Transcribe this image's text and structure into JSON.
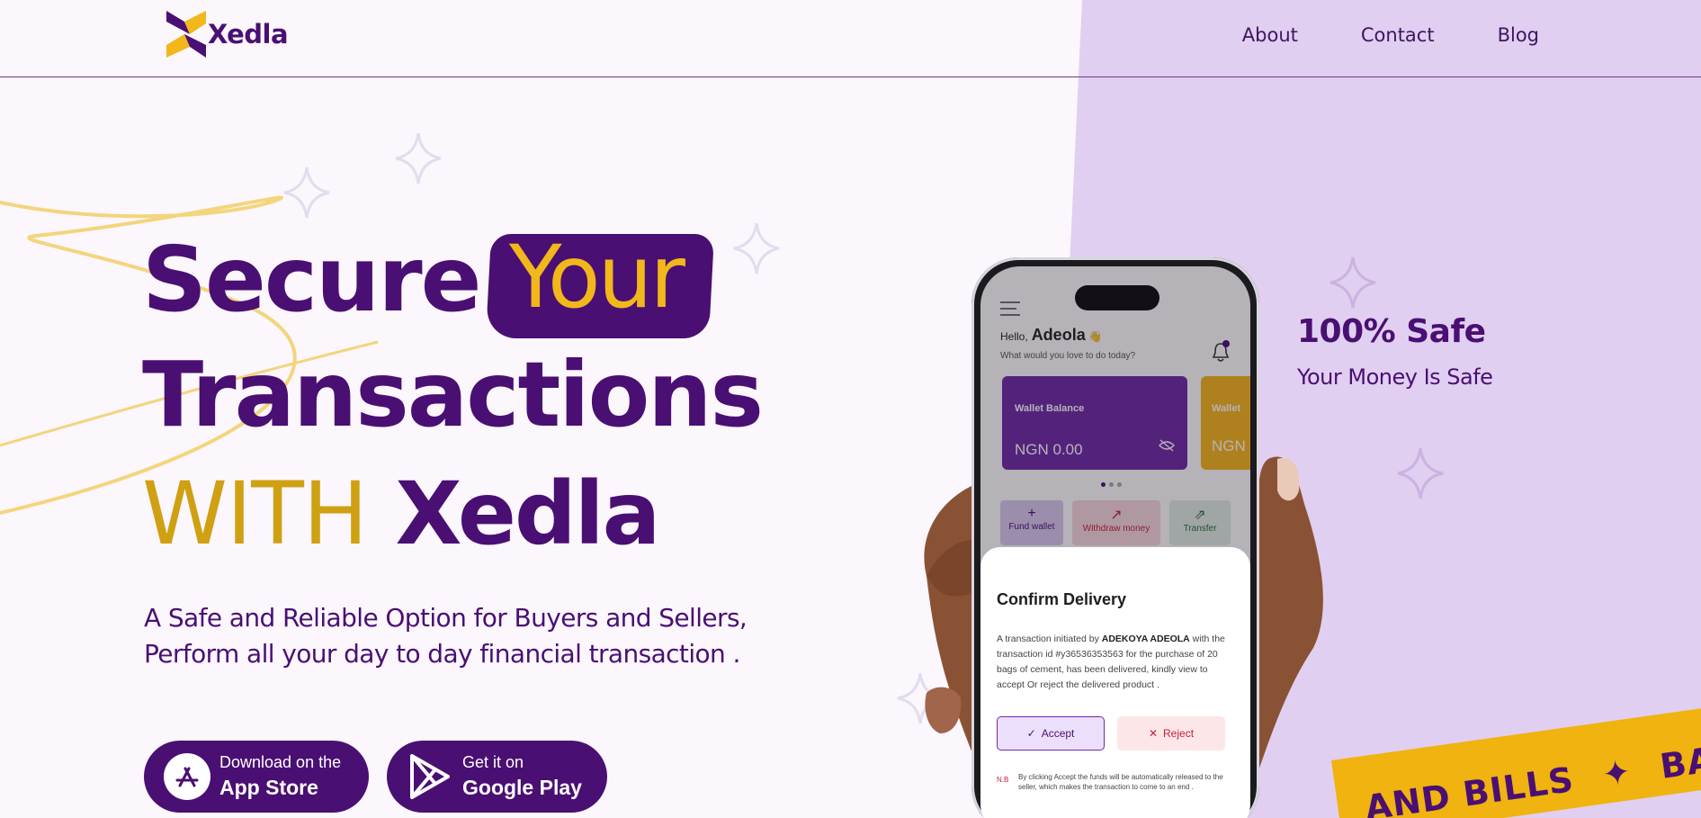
{
  "brand": {
    "name": "Xedla",
    "primary": "#4a0f73",
    "accent": "#f2b71a",
    "panel": "#e0cff0"
  },
  "nav": {
    "items": [
      "About",
      "Contact",
      "Blog"
    ]
  },
  "hero": {
    "line1_secure": "Secure",
    "line1_your": "Your",
    "line2": "Transactions",
    "line3_with": "WITH",
    "line3_brand": "Xedla",
    "subtitle_line1": "A Safe and Reliable Option for Buyers and Sellers,",
    "subtitle_line2": "Perform all your day to day financial transaction ."
  },
  "stores": {
    "apple": {
      "small": "Download on the",
      "big": "App Store",
      "icon": "app-store-icon"
    },
    "google": {
      "small": "Get it on",
      "big": "Google Play",
      "icon": "google-play-icon"
    }
  },
  "feature": {
    "title": "100% Safe",
    "subtitle": "Your Money Is Safe"
  },
  "ribbon": {
    "text": "AND BILLS",
    "text2": "BANK"
  },
  "phone": {
    "hello": "Hello,",
    "name": "Adeola",
    "emoji": "👋",
    "hello_sub": "What would you love to do today?",
    "wallet_label": "Wallet Balance",
    "wallet_amount": "NGN 0.00",
    "wallet2_label": "Wallet",
    "wallet2_amount": "NGN",
    "actions": [
      "Fund wallet",
      "Withdraw  money",
      "Transfer"
    ],
    "sheet_title": "Confirm Delivery",
    "sheet_body_pre": "A transaction initiated by ",
    "sheet_body_name": "ADEKOYA ADEOLA",
    "sheet_body_post": " with the transaction id #y36536353563 for the purchase of  20 bags of cement, has been delivered, kindly view to accept Or reject the delivered product  .",
    "accept": "Accept",
    "reject": "Reject",
    "nb_tag": "N.B",
    "nb_text": "By clicking Accept the funds will be automatically released to the seller, which makes the transaction to come to an end ."
  }
}
